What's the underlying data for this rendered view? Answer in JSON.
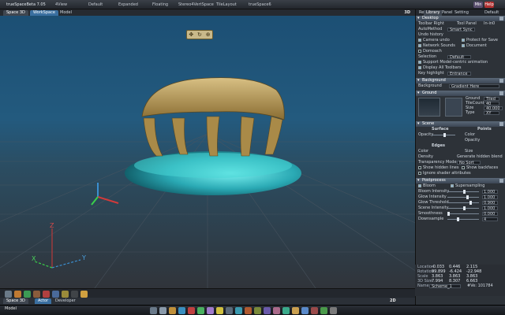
{
  "app": {
    "title": "trueSpaceBeta 7.05"
  },
  "menu": [
    "4View",
    "Default",
    "Expanded",
    "Floating",
    "Stereo4VertSpace",
    "TileLayout",
    "trueSpace6"
  ],
  "window_buttons": [
    "Min",
    "Help"
  ],
  "viewport_tabs": [
    "Space 3D",
    "WorkSpace",
    "Model"
  ],
  "view_mode_top": "3D",
  "view_mode_bottom": "2D",
  "bottom_tabs": [
    "Space 3D",
    "Actor",
    "Developer"
  ],
  "mode_label": "Model",
  "panel": {
    "tabs": [
      "Re",
      "Library",
      "Panel",
      "Setting"
    ],
    "default_label": "Default",
    "sections": {
      "desktop": {
        "title": "Desktop",
        "items": [
          {
            "label": "Toolbar",
            "value": "Right",
            "extra": "Tool Panel",
            "extra_value": "In-in0"
          },
          {
            "label": "AutoMethod",
            "value": "Smart Sync"
          },
          {
            "label": "Undo history"
          },
          {
            "label": "Camera undo",
            "checked": true,
            "right": "Protect for Save"
          },
          {
            "label": "Network Sounds",
            "checked": true,
            "right": "Document"
          },
          {
            "label": "Domoach",
            "checked": false
          },
          {
            "label": "Selection",
            "value": "Default"
          },
          {
            "label": "Support Model-centric animation",
            "checked": true
          },
          {
            "label": "Display All Toolbars",
            "checked": true
          },
          {
            "label": "Key highlight",
            "value": "Entrance"
          }
        ]
      },
      "background": {
        "title": "Background",
        "color_label": "Background",
        "value": "Gradient Here"
      },
      "ground": {
        "title": "Ground",
        "fields": [
          {
            "label": "Ground",
            "value": "Tiled"
          },
          {
            "label": "TileCount",
            "value": "40"
          },
          {
            "label": "Size",
            "value": "40.000"
          },
          {
            "label": "Type",
            "value": "XY"
          }
        ]
      },
      "scene": {
        "title": "Scene",
        "columns": [
          "Surface",
          "Points"
        ],
        "rows": [
          {
            "label": "Opacity",
            "right": "Color"
          },
          {
            "label": "",
            "right": "Opacity"
          },
          {
            "label": "Edges"
          },
          {
            "label": "Color",
            "right": "Size"
          },
          {
            "label": "Density",
            "right": "Generate hidden blend"
          },
          {
            "label": "Transparency Mode",
            "value": "No Sort"
          },
          {
            "label": "Show hidden lines",
            "right": "Show backfaces"
          },
          {
            "label": "Ignore shader attributes"
          }
        ]
      },
      "postprocess": {
        "title": "Postprocess",
        "columns": [
          "Bloom",
          "Supersampling"
        ],
        "sliders": [
          {
            "label": "Bloom Intensity",
            "value": "1.000",
            "k": 0.5
          },
          {
            "label": "Glow Intensity",
            "value": "1.000",
            "k": 0.6
          },
          {
            "label": "Glow Threshold",
            "value": "0.900",
            "k": 0.7
          },
          {
            "label": "Scene Intensity",
            "value": "1.000",
            "k": 0.5
          },
          {
            "label": "Smoothness",
            "value": "0.000",
            "k": 0.0
          },
          {
            "label": "Downsample",
            "value": "4",
            "k": 0.3
          }
        ]
      }
    }
  },
  "info": {
    "rows": [
      {
        "label": "Location",
        "x": "-0.033",
        "y": "0.446",
        "z": "2.115"
      },
      {
        "label": "Rotation",
        "x": "99.899",
        "y": "-6.424",
        "z": "-22.948"
      },
      {
        "label": "Scale",
        "x": "3.863",
        "y": "3.863",
        "z": "3.863"
      },
      {
        "label": "3D Size",
        "x": "7.994",
        "y": "8.307",
        "z": "6.663"
      }
    ],
    "name_label": "Name",
    "name_value": "Scheme_1",
    "verts": "#Ve: 101784"
  },
  "axis_labels": {
    "x": "X",
    "y": "Y",
    "z": "Z"
  },
  "colors": {
    "accent": "#3b8fd0",
    "object_top": "#b89a54",
    "object_base": "#3cc6cc"
  }
}
